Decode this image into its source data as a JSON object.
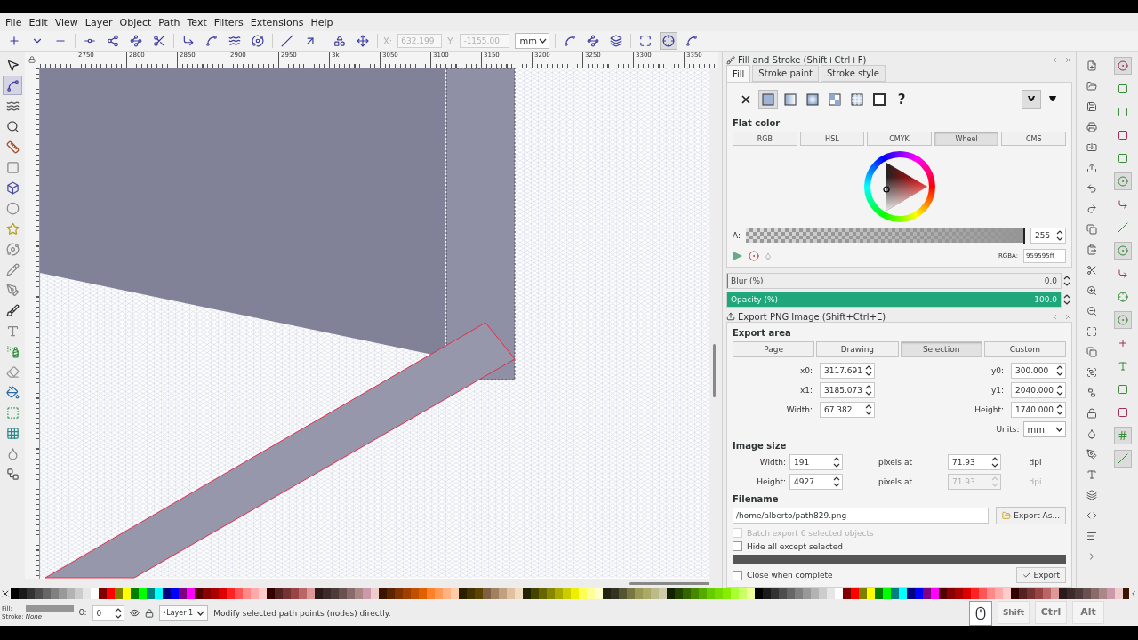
{
  "menu": [
    "File",
    "Edit",
    "View",
    "Layer",
    "Object",
    "Path",
    "Text",
    "Filters",
    "Extensions",
    "Help"
  ],
  "tool_controls": {
    "x_label": "X:",
    "x_value": "632.199",
    "y_label": "Y:",
    "y_value": "-1155.00",
    "unit": "mm",
    "toggles": [
      {
        "on": false
      },
      {
        "on": true
      },
      {
        "on": false
      }
    ]
  },
  "toolbox": [
    {
      "selected": false
    },
    {
      "selected": true
    },
    {
      "selected": false
    },
    {
      "selected": false
    },
    {
      "selected": false
    },
    {
      "selected": false
    },
    {
      "selected": false
    },
    {
      "selected": false
    },
    {
      "selected": false
    },
    {
      "selected": false
    },
    {
      "selected": false
    },
    {
      "selected": false
    },
    {
      "selected": false
    },
    {
      "selected": false
    },
    {
      "selected": false
    },
    {
      "selected": false
    },
    {
      "selected": false
    },
    {
      "selected": false
    },
    {
      "selected": false
    },
    {
      "selected": false
    },
    {
      "selected": false
    }
  ],
  "ruler_labels": [
    "2750",
    "2800",
    "2850",
    "2900",
    "2950",
    "3k",
    "3050",
    "3100",
    "3150",
    "3200",
    "3250",
    "3300",
    "3350"
  ],
  "fill_stroke": {
    "title": "Fill and Stroke (Shift+Ctrl+F)",
    "tabs": [
      {
        "label": "Fill",
        "selected": true
      },
      {
        "label": "Stroke paint",
        "selected": false
      },
      {
        "label": "Stroke style",
        "selected": false
      }
    ],
    "paint_types": [
      {
        "kind": "none",
        "selected": false
      },
      {
        "kind": "flat",
        "selected": true
      },
      {
        "kind": "linear",
        "selected": false
      },
      {
        "kind": "radial",
        "selected": false
      },
      {
        "kind": "pattern",
        "selected": false
      },
      {
        "kind": "mesh",
        "selected": false
      },
      {
        "kind": "swatch",
        "selected": false
      },
      {
        "kind": "unset",
        "label": "?",
        "selected": false
      }
    ],
    "fill_rules": [
      {
        "selected": true
      },
      {
        "selected": false
      }
    ],
    "flat_color_label": "Flat color",
    "modes": [
      {
        "label": "RGB",
        "selected": false
      },
      {
        "label": "HSL",
        "selected": false
      },
      {
        "label": "CMYK",
        "selected": false
      },
      {
        "label": "Wheel",
        "selected": true
      },
      {
        "label": "CMS",
        "selected": false
      }
    ],
    "alpha": {
      "label": "A:",
      "value": "255",
      "level": 1
    },
    "rgba_label": "RGBA:",
    "rgba_value": "959595ff",
    "blur": {
      "label": "Blur (%)",
      "value": "0.0",
      "level": 0
    },
    "opacity": {
      "label": "Opacity (%)",
      "value": "100.0",
      "level": 1
    }
  },
  "export_png": {
    "title": "Export PNG Image (Shift+Ctrl+E)",
    "area_label": "Export area",
    "areas": [
      {
        "label": "Page",
        "selected": false
      },
      {
        "label": "Drawing",
        "selected": false
      },
      {
        "label": "Selection",
        "selected": true
      },
      {
        "label": "Custom",
        "selected": false
      }
    ],
    "coords": [
      {
        "label": "x0:",
        "value": "3117.691"
      },
      {
        "label": "y0:",
        "value": "300.000"
      },
      {
        "label": "x1:",
        "value": "3185.073"
      },
      {
        "label": "y1:",
        "value": "2040.000"
      },
      {
        "label": "Width:",
        "value": "67.382"
      },
      {
        "label": "Height:",
        "value": "1740.000"
      }
    ],
    "units_label": "Units:",
    "units": "mm",
    "image_size_label": "Image size",
    "size_rows": [
      {
        "label": "Width:",
        "value": "191",
        "middle": "pixels at",
        "dpi": "71.93",
        "unit": "dpi",
        "disabled": false
      },
      {
        "label": "Height:",
        "value": "4927",
        "middle": "pixels at",
        "dpi": "71.93",
        "unit": "dpi",
        "disabled": true
      }
    ],
    "filename_label": "Filename",
    "filename": "/home/alberto/path829.png",
    "export_as": "Export As...",
    "options": [
      {
        "label": "Batch export 6 selected objects",
        "checked": false,
        "disabled": true
      },
      {
        "label": "Hide all except selected",
        "checked": false,
        "disabled": false
      }
    ],
    "progress": {
      "level": 1
    },
    "close_option": {
      "label": "Close when complete",
      "checked": false
    },
    "export_button": "Export"
  },
  "snap_bar": [
    {
      "on": true
    },
    {
      "on": false
    },
    {
      "on": false
    },
    {
      "on": false
    },
    {
      "on": false
    },
    {
      "on": true
    },
    {
      "on": false
    },
    {
      "on": false
    },
    {
      "on": true
    },
    {
      "on": false
    },
    {
      "on": false
    },
    {
      "on": true
    },
    {
      "on": false
    },
    {
      "on": false
    },
    {
      "on": false
    },
    {
      "on": false
    },
    {
      "on": true
    },
    {
      "on": true
    }
  ],
  "status": {
    "fill_label": "Fill:",
    "stroke_label": "Stroke:",
    "stroke_value": "None",
    "opacity_label": "O:",
    "opacity_value": "0",
    "layer": "•Layer 1",
    "message": "Modify selected path points (nodes) directly.",
    "keys": [
      {
        "label": "Shift",
        "on": false
      },
      {
        "label": "Ctrl",
        "on": false
      },
      {
        "label": "Alt",
        "on": false
      }
    ]
  }
}
